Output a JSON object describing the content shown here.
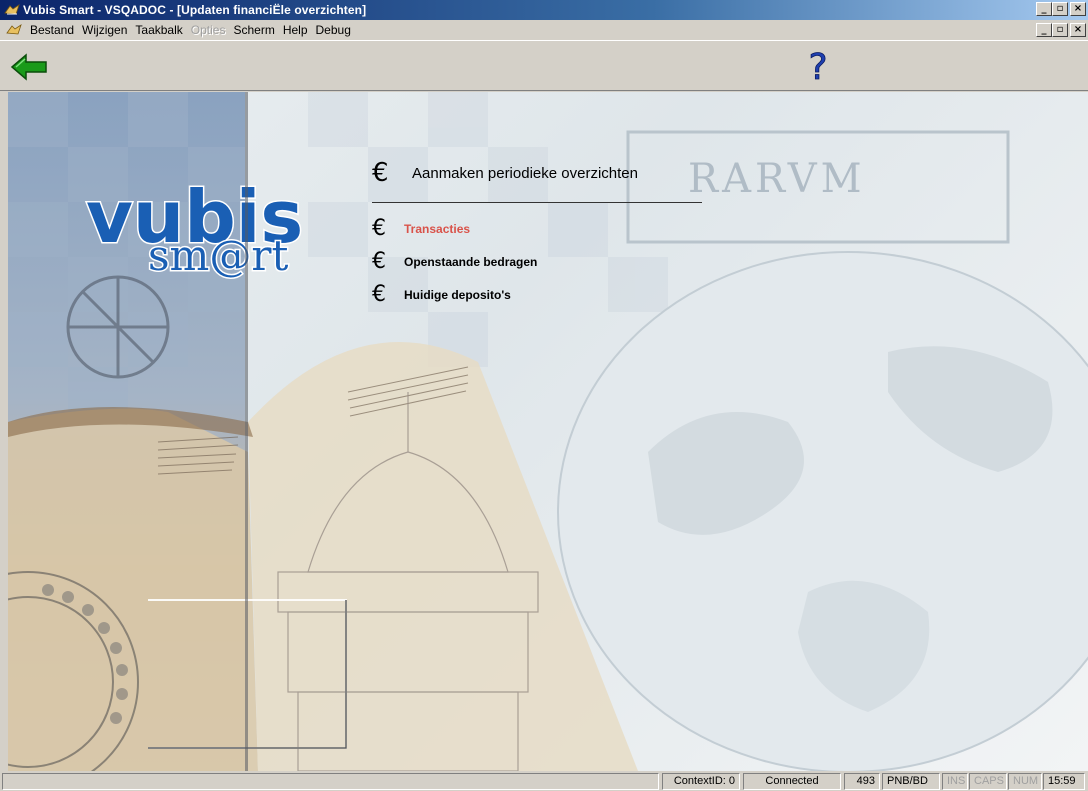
{
  "window": {
    "title": "Vubis Smart - VSQADOC - [Updaten financiËle overzichten]",
    "controls": [
      "_",
      "🗗",
      "×"
    ]
  },
  "menubar": {
    "items": [
      {
        "label": "Bestand",
        "enabled": true
      },
      {
        "label": "Wijzigen",
        "enabled": true
      },
      {
        "label": "Taakbalk",
        "enabled": true
      },
      {
        "label": "Opties",
        "enabled": false
      },
      {
        "label": "Scherm",
        "enabled": true
      },
      {
        "label": "Help",
        "enabled": true
      },
      {
        "label": "Debug",
        "enabled": true
      }
    ]
  },
  "toolbar": {
    "back_icon": "green-arrow-left-icon",
    "help_glyph": "?",
    "help_icon": "question-mark-icon"
  },
  "logo": {
    "line1": "vubis",
    "line2": "sm@rt"
  },
  "menu": {
    "symbol": "€",
    "heading": "Aanmaken periodieke overzichten",
    "items": [
      {
        "label": "Transacties",
        "active": true
      },
      {
        "label": "Openstaande bedragen",
        "active": false
      },
      {
        "label": "Huidige deposito's",
        "active": false
      }
    ]
  },
  "background_text": "RARVM",
  "statusbar": {
    "context": "ContextID: 0",
    "connection": "Connected",
    "count": "493",
    "location": "PNB/BD",
    "ins": "INS",
    "caps": "CAPS",
    "num": "NUM",
    "time": "15:59"
  },
  "colors": {
    "title_gradient_start": "#0a246a",
    "active_item": "#d9534a",
    "back_arrow": "#1a9a1a",
    "help_mark": "#1f3fb0",
    "logo_blue": "#1a5fb4"
  }
}
